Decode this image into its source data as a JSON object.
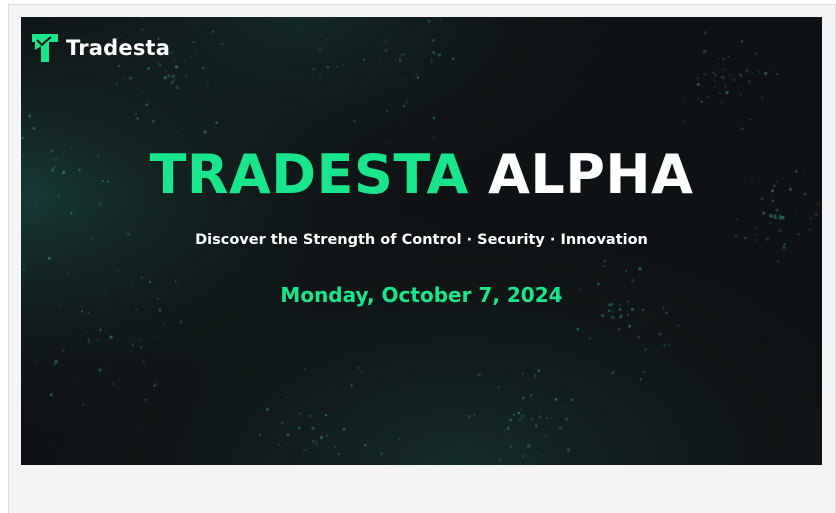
{
  "brand": {
    "name": "Tradesta",
    "logo_icon": "tradesta-t-logo-icon",
    "accent_color": "#19e68c"
  },
  "hero": {
    "title_accent": "TRADESTA",
    "title_plain": "ALPHA",
    "tagline": "Discover the Strength of Control · Security · Innovation",
    "date": "Monday, October 7, 2024",
    "background_color": "#0f1214"
  }
}
